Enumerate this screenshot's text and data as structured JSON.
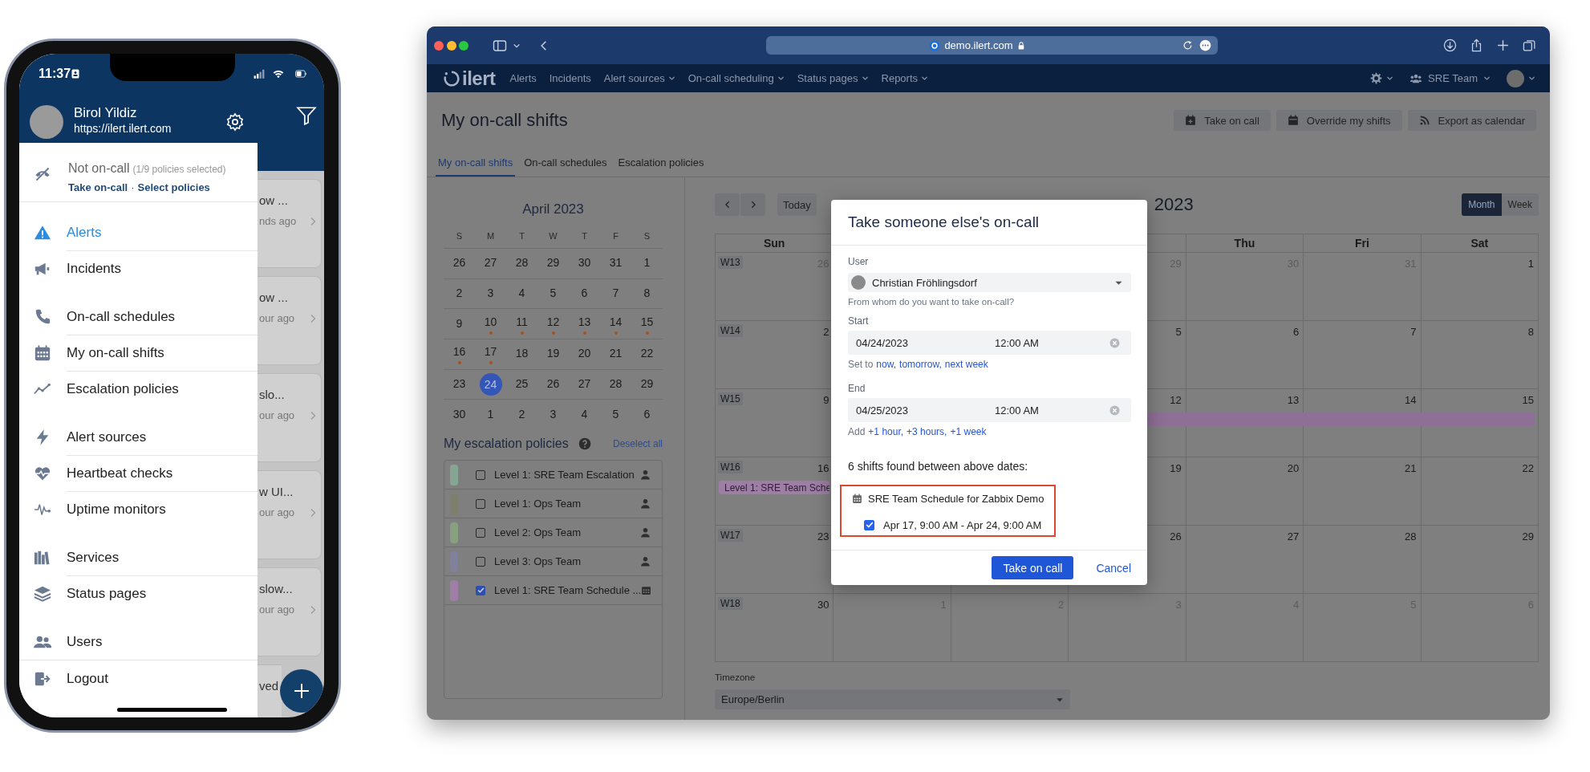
{
  "phone": {
    "time": "11:37",
    "drawer": {
      "user_name": "Birol Yildiz",
      "user_url": "https://ilert.ilert.com",
      "status": "Not on-call",
      "status_detail": "(1/9 policies selected)",
      "status_links": [
        "Take on-call",
        "Select policies"
      ],
      "link_separator": "·",
      "menu_groups": [
        [
          {
            "label": "Alerts",
            "selected": true
          },
          {
            "label": "Incidents",
            "selected": false
          }
        ],
        [
          {
            "label": "On-call schedules",
            "selected": false
          },
          {
            "label": "My on-call shifts",
            "selected": false
          },
          {
            "label": "Escalation policies",
            "selected": false
          }
        ],
        [
          {
            "label": "Alert sources",
            "selected": false
          },
          {
            "label": "Heartbeat checks",
            "selected": false
          },
          {
            "label": "Uptime monitors",
            "selected": false
          }
        ],
        [
          {
            "label": "Services",
            "selected": false
          },
          {
            "label": "Status pages",
            "selected": false
          }
        ],
        [
          {
            "label": "Users",
            "selected": false
          }
        ],
        [
          {
            "label": "Logout",
            "selected": false
          }
        ]
      ]
    },
    "alert_cards": [
      {
        "title": "ow ...",
        "time": "nds ago"
      },
      {
        "title": "ow ...",
        "time": "our ago"
      },
      {
        "title": "slo...",
        "time": "our ago"
      },
      {
        "title": "w UI...",
        "time": "our ago"
      },
      {
        "title": "slow...",
        "time": "our ago"
      },
      {
        "title": "ved"
      }
    ]
  },
  "browser": {
    "address": "demo.ilert.com",
    "nav": {
      "brand": "ilert",
      "items": [
        {
          "label": "Alerts",
          "dropdown": false
        },
        {
          "label": "Incidents",
          "dropdown": false
        },
        {
          "label": "Alert sources",
          "dropdown": true
        },
        {
          "label": "On-call scheduling",
          "dropdown": true
        },
        {
          "label": "Status pages",
          "dropdown": true
        },
        {
          "label": "Reports",
          "dropdown": true
        }
      ],
      "team": "SRE Team"
    },
    "page": {
      "title": "My on-call shifts",
      "actions": [
        "Take on call",
        "Override my shifts",
        "Export as calendar"
      ],
      "tabs": [
        {
          "label": "My on-call shifts",
          "selected": true
        },
        {
          "label": "On-call schedules",
          "selected": false
        },
        {
          "label": "Escalation policies",
          "selected": false
        }
      ],
      "mini_calendar": {
        "title": "April 2023",
        "weekdays": [
          "S",
          "M",
          "T",
          "W",
          "T",
          "F",
          "S"
        ],
        "weeks": [
          [
            {
              "day": "26",
              "dot": false,
              "selected": false
            },
            {
              "day": "27",
              "dot": false,
              "selected": false
            },
            {
              "day": "28",
              "dot": false,
              "selected": false
            },
            {
              "day": "29",
              "dot": false,
              "selected": false
            },
            {
              "day": "30",
              "dot": false,
              "selected": false
            },
            {
              "day": "31",
              "dot": false,
              "selected": false
            },
            {
              "day": "1",
              "dot": false,
              "selected": false
            }
          ],
          [
            {
              "day": "2",
              "dot": false,
              "selected": false
            },
            {
              "day": "3",
              "dot": false,
              "selected": false
            },
            {
              "day": "4",
              "dot": false,
              "selected": false
            },
            {
              "day": "5",
              "dot": false,
              "selected": false
            },
            {
              "day": "6",
              "dot": false,
              "selected": false
            },
            {
              "day": "7",
              "dot": false,
              "selected": false
            },
            {
              "day": "8",
              "dot": false,
              "selected": false
            }
          ],
          [
            {
              "day": "9",
              "dot": false,
              "selected": false
            },
            {
              "day": "10",
              "dot": true,
              "selected": false
            },
            {
              "day": "11",
              "dot": true,
              "selected": false
            },
            {
              "day": "12",
              "dot": true,
              "selected": false
            },
            {
              "day": "13",
              "dot": true,
              "selected": false
            },
            {
              "day": "14",
              "dot": true,
              "selected": false
            },
            {
              "day": "15",
              "dot": true,
              "selected": false
            }
          ],
          [
            {
              "day": "16",
              "dot": true,
              "selected": false
            },
            {
              "day": "17",
              "dot": true,
              "selected": false
            },
            {
              "day": "18",
              "dot": false,
              "selected": false
            },
            {
              "day": "19",
              "dot": false,
              "selected": false
            },
            {
              "day": "20",
              "dot": false,
              "selected": false
            },
            {
              "day": "21",
              "dot": false,
              "selected": false
            },
            {
              "day": "22",
              "dot": false,
              "selected": false
            }
          ],
          [
            {
              "day": "23",
              "dot": false,
              "selected": false
            },
            {
              "day": "24",
              "dot": false,
              "selected": true
            },
            {
              "day": "25",
              "dot": false,
              "selected": false
            },
            {
              "day": "26",
              "dot": false,
              "selected": false
            },
            {
              "day": "27",
              "dot": false,
              "selected": false
            },
            {
              "day": "28",
              "dot": false,
              "selected": false
            },
            {
              "day": "29",
              "dot": false,
              "selected": false
            }
          ],
          [
            {
              "day": "30",
              "dot": false,
              "selected": false
            },
            {
              "day": "1",
              "dot": false,
              "selected": false
            },
            {
              "day": "2",
              "dot": false,
              "selected": false
            },
            {
              "day": "3",
              "dot": false,
              "selected": false
            },
            {
              "day": "4",
              "dot": false,
              "selected": false
            },
            {
              "day": "5",
              "dot": false,
              "selected": false
            },
            {
              "day": "6",
              "dot": false,
              "selected": false
            }
          ]
        ]
      },
      "policies": {
        "title": "My escalation policies",
        "action": "Deselect all",
        "items": [
          {
            "label": "Level 1: SRE Team Escalation",
            "color": "#86a592",
            "checked": false,
            "kind": "user"
          },
          {
            "label": "Level 1: Ops Team",
            "color": "#7e7f6c",
            "checked": false,
            "kind": "user"
          },
          {
            "label": "Level 2: Ops Team",
            "color": "#87a07f",
            "checked": false,
            "kind": "user"
          },
          {
            "label": "Level 3: Ops Team",
            "color": "#80809a",
            "checked": false,
            "kind": "user"
          },
          {
            "label": "Level 1: SRE Team Schedule ...",
            "color": "#9f7ea6",
            "checked": true,
            "kind": "schedule"
          }
        ]
      },
      "calendar": {
        "today": "Today",
        "title": "2023",
        "views": [
          {
            "label": "Month",
            "selected": true
          },
          {
            "label": "Week",
            "selected": false
          }
        ],
        "columns": {
          "sun": "Sun",
          "thu": "Thu",
          "fri": "Fri",
          "sat": "Sat"
        },
        "weeks": [
          {
            "label": "W13",
            "days": {
              "sun": {
                "day": "26",
                "muted": true
              },
              "wed": {
                "day": "29",
                "muted": true
              },
              "thu": {
                "day": "30",
                "muted": true
              },
              "fri": {
                "day": "31",
                "muted": true
              },
              "sat": {
                "day": "1",
                "muted": false
              }
            }
          },
          {
            "label": "W14",
            "days": {
              "sun": {
                "day": "2",
                "muted": false
              },
              "wed": {
                "day": "5",
                "muted": false
              },
              "thu": {
                "day": "6",
                "muted": false
              },
              "fri": {
                "day": "7",
                "muted": false
              },
              "sat": {
                "day": "8",
                "muted": false
              }
            }
          },
          {
            "label": "W15",
            "event": {
              "color": "#8e6f96"
            },
            "days": {
              "sun": {
                "day": "9",
                "muted": false
              },
              "wed": {
                "day": "12",
                "muted": false,
                "event": true
              },
              "thu": {
                "day": "13",
                "muted": false,
                "event": true
              },
              "fri": {
                "day": "14",
                "muted": false,
                "event": true
              },
              "sat": {
                "day": "15",
                "muted": false,
                "event": true
              }
            }
          },
          {
            "label": "W16",
            "event": {
              "color": "#9f7ea6",
              "label": "Level 1: SRE Team Sche"
            },
            "days": {
              "sun": {
                "day": "16",
                "muted": false,
                "event": true
              },
              "wed": {
                "day": "19",
                "muted": false
              },
              "thu": {
                "day": "20",
                "muted": false
              },
              "fri": {
                "day": "21",
                "muted": false
              },
              "sat": {
                "day": "22",
                "muted": false
              }
            }
          },
          {
            "label": "W17",
            "days": {
              "sun": {
                "day": "23",
                "muted": false
              },
              "wed": {
                "day": "26",
                "muted": false
              },
              "thu": {
                "day": "27",
                "muted": false
              },
              "fri": {
                "day": "28",
                "muted": false
              },
              "sat": {
                "day": "29",
                "muted": false
              }
            }
          },
          {
            "label": "W18",
            "days": {
              "sun": {
                "day": "30",
                "muted": false
              },
              "mon": {
                "day": "1",
                "muted": true
              },
              "tue": {
                "day": "2",
                "muted": true
              },
              "wed": {
                "day": "3",
                "muted": true
              },
              "thu": {
                "day": "4",
                "muted": true
              },
              "fri": {
                "day": "5",
                "muted": true
              },
              "sat": {
                "day": "6",
                "muted": true
              }
            }
          }
        ],
        "timezone": {
          "label": "Timezone",
          "value": "Europe/Berlin"
        }
      },
      "dialog": {
        "title": "Take someone else's on-call",
        "user": {
          "label": "User",
          "value": "Christian Fröhlingsdorf",
          "hint": "From whom do you want to take on-call?"
        },
        "start": {
          "label": "Start",
          "date": "04/24/2023",
          "time": "12:00 AM",
          "prefix": "Set to",
          "links": [
            "now,",
            "tomorrow,",
            "next week"
          ]
        },
        "end": {
          "label": "End",
          "date": "04/25/2023",
          "time": "12:00 AM",
          "prefix": "Add",
          "links": [
            "+1 hour,",
            "+3 hours,",
            "+1 week"
          ]
        },
        "result": "6 shifts found between above dates:",
        "highlighted": true,
        "schedule": "SRE Team Schedule for Zabbix Demo",
        "shifts": [
          {
            "label": "Apr 17, 9:00 AM - Apr 24, 9:00 AM",
            "checked": true
          }
        ],
        "primary": "Take on call",
        "secondary": "Cancel"
      }
    }
  }
}
